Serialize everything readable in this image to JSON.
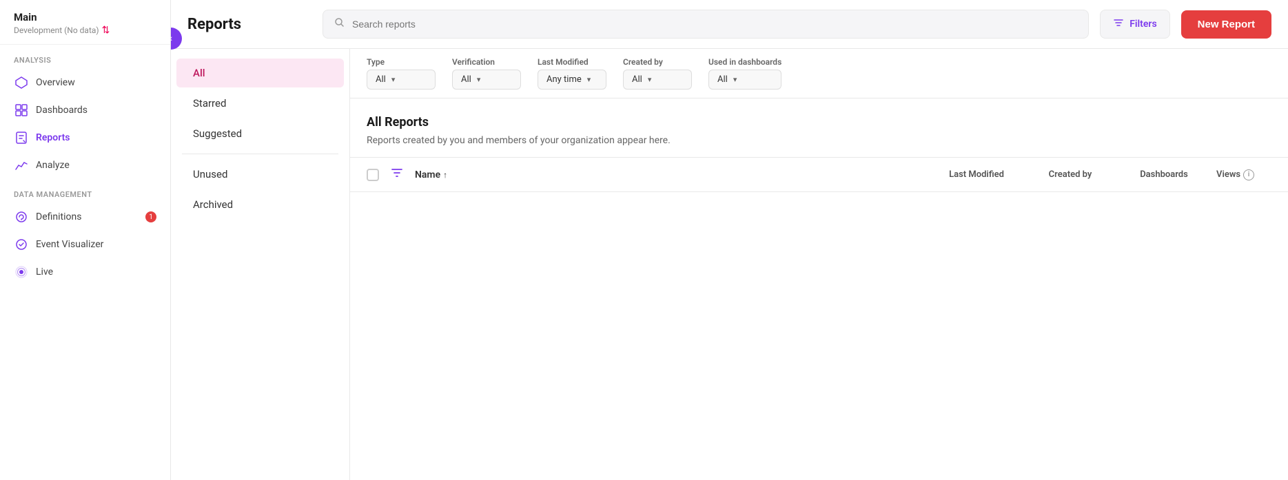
{
  "sidebar": {
    "app_name": "Main",
    "sub_name": "Development (No data)",
    "sections": [
      {
        "label": "Analysis",
        "items": [
          {
            "id": "overview",
            "label": "Overview",
            "icon": "⬡",
            "active": false
          },
          {
            "id": "dashboards",
            "label": "Dashboards",
            "icon": "▦",
            "active": false
          },
          {
            "id": "reports",
            "label": "Reports",
            "icon": "📊",
            "active": true
          },
          {
            "id": "analyze",
            "label": "Analyze",
            "icon": "📈",
            "active": false
          }
        ]
      },
      {
        "label": "Data Management",
        "items": [
          {
            "id": "definitions",
            "label": "Definitions",
            "icon": "❋",
            "active": false,
            "badge": "1"
          },
          {
            "id": "event-visualizer",
            "label": "Event Visualizer",
            "icon": "✓",
            "active": false
          },
          {
            "id": "live",
            "label": "Live",
            "icon": "((·))",
            "active": false
          }
        ]
      }
    ]
  },
  "header": {
    "title": "Reports",
    "search_placeholder": "Search reports",
    "filters_label": "Filters",
    "new_report_label": "New Report"
  },
  "left_nav": {
    "items": [
      {
        "id": "all",
        "label": "All",
        "active": true
      },
      {
        "id": "starred",
        "label": "Starred",
        "active": false
      },
      {
        "id": "suggested",
        "label": "Suggested",
        "active": false
      },
      {
        "divider": true
      },
      {
        "id": "unused",
        "label": "Unused",
        "active": false
      },
      {
        "id": "archived",
        "label": "Archived",
        "active": false
      }
    ]
  },
  "filters": {
    "type": {
      "label": "Type",
      "value": "All"
    },
    "verification": {
      "label": "Verification",
      "value": "All"
    },
    "last_modified": {
      "label": "Last Modified",
      "value": "Any time"
    },
    "created_by": {
      "label": "Created by",
      "value": "All"
    },
    "used_in_dashboards": {
      "label": "Used in dashboards",
      "value": "All"
    }
  },
  "all_reports": {
    "title": "All Reports",
    "description": "Reports created by you and members of your organization appear here."
  },
  "table": {
    "col_name": "Name",
    "col_last_modified": "Last Modified",
    "col_created_by": "Created by",
    "col_dashboards": "Dashboards",
    "col_views": "Views"
  }
}
